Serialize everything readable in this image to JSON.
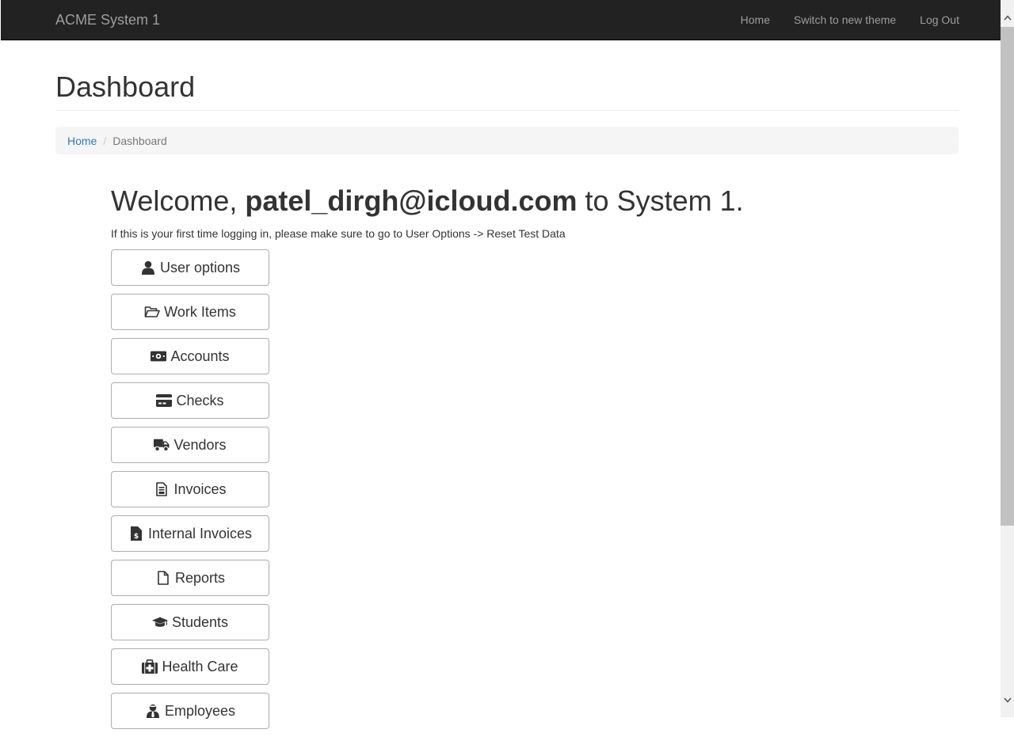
{
  "navbar": {
    "brand": "ACME System 1",
    "links": [
      "Home",
      "Switch to new theme",
      "Log Out"
    ]
  },
  "page": {
    "title": "Dashboard",
    "breadcrumb": {
      "home": "Home",
      "separator": "/",
      "current": "Dashboard"
    }
  },
  "welcome": {
    "prefix": "Welcome, ",
    "user": "patel_dirgh@icloud.com",
    "suffix": " to System 1.",
    "notice": "If this is your first time logging in, please make sure to go to User Options -> Reset Test Data"
  },
  "menu": [
    {
      "label": "User options",
      "icon": "user-icon"
    },
    {
      "label": "Work Items",
      "icon": "folder-open-icon"
    },
    {
      "label": "Accounts",
      "icon": "money-icon"
    },
    {
      "label": "Checks",
      "icon": "credit-card-icon"
    },
    {
      "label": "Vendors",
      "icon": "truck-icon"
    },
    {
      "label": "Invoices",
      "icon": "invoice-icon"
    },
    {
      "label": "Internal Invoices",
      "icon": "file-dollar-icon"
    },
    {
      "label": "Reports",
      "icon": "file-icon"
    },
    {
      "label": "Students",
      "icon": "graduation-cap-icon"
    },
    {
      "label": "Health Care",
      "icon": "medkit-icon"
    },
    {
      "label": "Employees",
      "icon": "user-tie-icon"
    }
  ],
  "colors": {
    "navbar_bg": "#222222",
    "navbar_text": "#9d9d9d",
    "link": "#337ab7",
    "breadcrumb_bg": "#f5f5f5"
  }
}
